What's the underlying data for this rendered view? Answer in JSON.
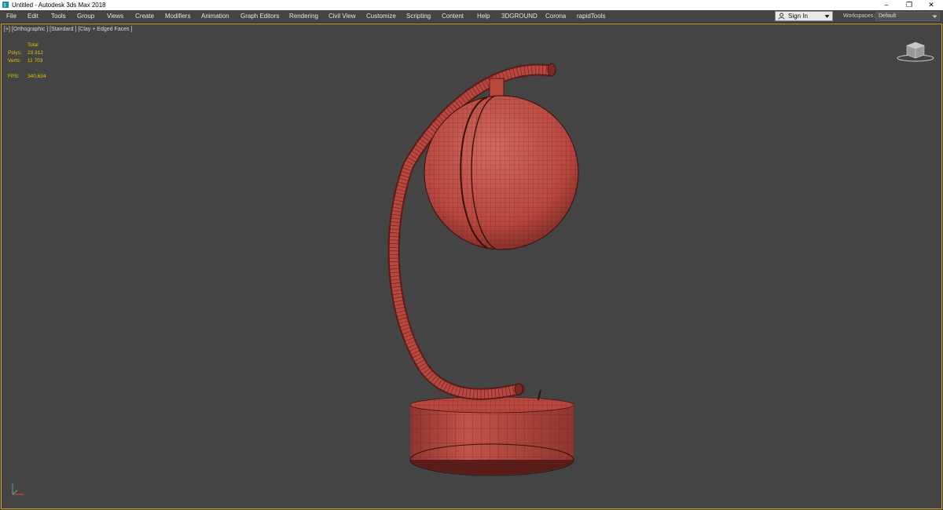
{
  "window": {
    "title": "Untitled - Autodesk 3ds Max 2018",
    "minimize_glyph": "–",
    "maximize_glyph": "❐",
    "close_glyph": "✕"
  },
  "menu": {
    "items": [
      "File",
      "Edit",
      "Tools",
      "Group",
      "Views",
      "Create",
      "Modifiers",
      "Animation",
      "Graph Editors",
      "Rendering",
      "Civil View",
      "Customize",
      "Scripting",
      "Content",
      "Help",
      "3DGROUND",
      "Corona",
      "rapidTools"
    ]
  },
  "account": {
    "sign_in_label": "Sign In"
  },
  "workspaces": {
    "label": "Workspaces:",
    "value": "Default"
  },
  "viewport": {
    "label": "[+] [Orthographic ] [Standard ] [Clay + Edged Faces ]",
    "stats": {
      "total_label": "Total",
      "polys_label": "Polys:",
      "polys_value": "23 312",
      "verts_label": "Verts:",
      "verts_value": "11 703",
      "fps_label": "FPS:",
      "fps_value": "340,634"
    }
  },
  "icons": {
    "app": "3ds-max-logo-icon",
    "user": "user-icon",
    "dropdown": "chevron-down-icon",
    "viewcube": "viewcube-icon",
    "axis": "axis-tripod-icon"
  },
  "colors": {
    "viewport_bg": "#444444",
    "menu_bg": "#444444",
    "active_border": "#c9a227",
    "stats_text": "#e8c300",
    "model_fill": "#b8473f",
    "model_wire": "#4a1512"
  }
}
